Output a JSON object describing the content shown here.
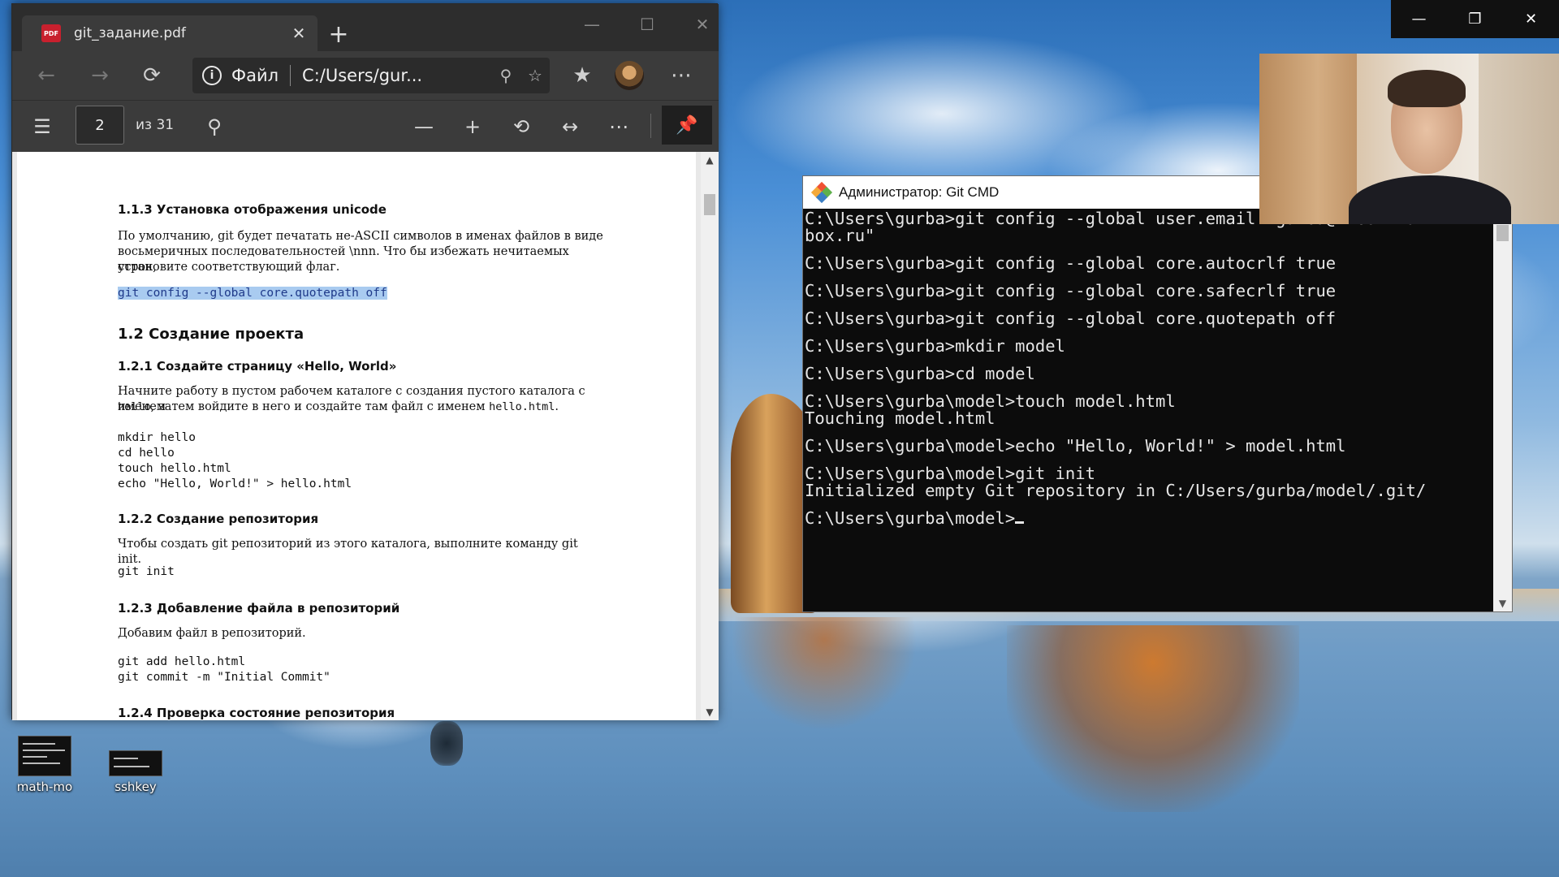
{
  "desktop": {
    "icons": [
      {
        "label": "math-mo",
        "icon": "terminal-thumbnail-icon"
      },
      {
        "label": "sshkey",
        "icon": "terminal-thumbnail-icon"
      }
    ]
  },
  "edge": {
    "tab_title": "git_задание.pdf",
    "pdf_badge": "PDF",
    "address": {
      "prefix": "Файл",
      "url": "C:/Users/gur..."
    },
    "pdf_toolbar": {
      "page_current": "2",
      "page_total": "из 31"
    },
    "pdf_content": {
      "s113": "1.1.3  Установка отображения unicode",
      "p113_1": "По умолчанию, git будет печатать не-ASCII символов в именах файлов в виде",
      "p113_2": "восьмеричных последовательностей \\nnn. Что бы избежать нечитаемых строк,",
      "p113_3": "установите соответствующий флаг.",
      "c113": "git config --global core.quotepath off",
      "s12": "1.2  Создание проекта",
      "s121": "1.2.1  Создайте страницу «Hello, World»",
      "p121_1": "Начните работу в пустом рабочем каталоге с создания пустого каталога с именем",
      "p121_2a": "hello",
      "p121_2b": ", затем войдите в него и создайте там файл с именем ",
      "p121_2c": "hello.html",
      "p121_2d": ".",
      "c121_1": "mkdir hello",
      "c121_2": "cd hello",
      "c121_3": "touch hello.html",
      "c121_4": "echo \"Hello, World!\" > hello.html",
      "s122": "1.2.2  Создание репозитория",
      "p122": "Чтобы создать git репозиторий из этого каталога, выполните команду git init.",
      "c122": "git init",
      "s123": "1.2.3  Добавление файла в репозиторий",
      "p123": "Добавим файл в репозиторий.",
      "c123_1": "git add hello.html",
      "c123_2": "git commit -m \"Initial Commit\"",
      "s124": "1.2.4  Проверка состояние репозитория"
    }
  },
  "cmd": {
    "title": "Администратор: Git CMD",
    "lines": [
      "C:\\Users\\gurba>git config --global user.email \"gurba@inbox.ru\"",
      "box.ru\"",
      "",
      "C:\\Users\\gurba>git config --global core.autocrlf true",
      "",
      "C:\\Users\\gurba>git config --global core.safecrlf true",
      "",
      "C:\\Users\\gurba>git config --global core.quotepath off",
      "",
      "C:\\Users\\gurba>mkdir model",
      "",
      "C:\\Users\\gurba>cd model",
      "",
      "C:\\Users\\gurba\\model>touch model.html",
      "Touching model.html",
      "",
      "C:\\Users\\gurba\\model>echo \"Hello, World!\" > model.html",
      "",
      "C:\\Users\\gurba\\model>git init",
      "Initialized empty Git repository in C:/Users/gurba/model/.git/",
      ""
    ],
    "prompt": "C:\\Users\\gurba\\model>"
  }
}
